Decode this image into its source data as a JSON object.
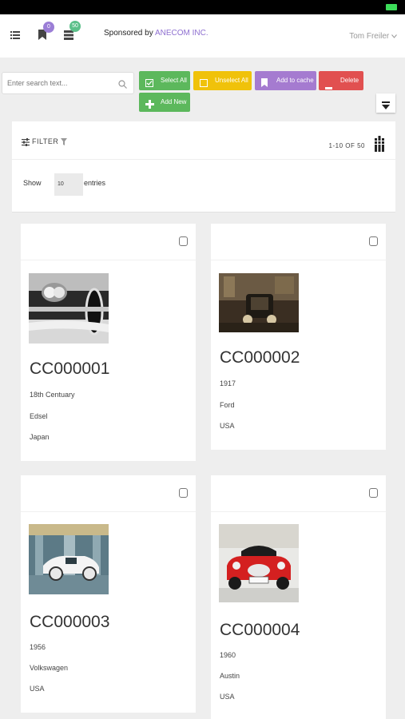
{
  "header": {
    "bookmark_count": "0",
    "list_count": "50",
    "sponsor_prefix": "Sponsored by",
    "sponsor_brand": "ANECOM INC.",
    "user_name": "Tom Freiler"
  },
  "toolbar": {
    "search_placeholder": "Enter search text...",
    "buttons": {
      "select_all": "Select All",
      "unselect_all": "Unselect All",
      "add_to_cache": "Add to cache",
      "delete": "Delete",
      "add_new": "Add New"
    }
  },
  "colors": {
    "select_all": "#5cb85c",
    "unselect_all": "#f0c20a",
    "add_to_cache": "#a57bd0",
    "delete": "#e15050",
    "add_new": "#5cb85c",
    "brand": "#8e6fd0"
  },
  "panel": {
    "filter_label": "FILTER",
    "range_text": "1-10 OF 50",
    "show_label": "Show",
    "entries_value": "10",
    "entries_label": "entries"
  },
  "cards": [
    {
      "id": "CC000001",
      "field1": "18th Centuary",
      "field2": "Edsel",
      "field3": "Japan",
      "image": "edsel-grille-photo"
    },
    {
      "id": "CC000002",
      "field1": "1917",
      "field2": "Ford",
      "field3": "USA",
      "image": "vintage-ford-photo"
    },
    {
      "id": "CC000003",
      "field1": "1956",
      "field2": "Volkswagen",
      "field3": "USA",
      "image": "white-classic-car-photo"
    },
    {
      "id": "CC000004",
      "field1": "1960",
      "field2": "Austin",
      "field3": "USA",
      "image": "red-austin-roadster-photo"
    }
  ]
}
